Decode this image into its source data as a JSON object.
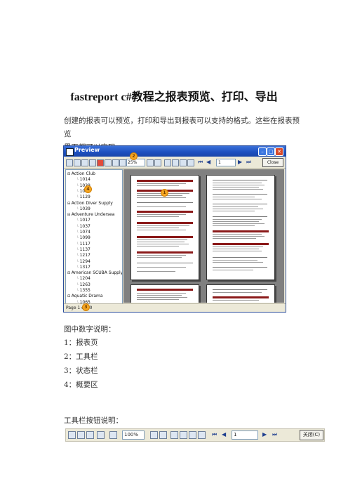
{
  "title": "fastreport c#教程之报表预览、打印、导出",
  "intro_line1": "创建的报表可以预览，打印和导出到报表可以支持的格式。这些在报表预览",
  "intro_line2": "界面都可以实现。",
  "preview_window": {
    "window_title": "Preview",
    "zoom": "25%",
    "page_number": "1",
    "close_label": "Close",
    "status_text": "Page 1 of 30",
    "tree": [
      {
        "type": "group",
        "label": "Action Club"
      },
      {
        "type": "leaf",
        "label": "1014"
      },
      {
        "type": "leaf",
        "label": "1029"
      },
      {
        "type": "leaf",
        "label": "1038"
      },
      {
        "type": "leaf",
        "label": "1129"
      },
      {
        "type": "group",
        "label": "Action Diver Supply"
      },
      {
        "type": "leaf",
        "label": "1039"
      },
      {
        "type": "group",
        "label": "Adventure Undersea"
      },
      {
        "type": "leaf",
        "label": "1017"
      },
      {
        "type": "leaf",
        "label": "1037"
      },
      {
        "type": "leaf",
        "label": "1074"
      },
      {
        "type": "leaf",
        "label": "1099"
      },
      {
        "type": "leaf",
        "label": "1117"
      },
      {
        "type": "leaf",
        "label": "1137"
      },
      {
        "type": "leaf",
        "label": "1217"
      },
      {
        "type": "leaf",
        "label": "1294"
      },
      {
        "type": "leaf",
        "label": "1317"
      },
      {
        "type": "group",
        "label": "American SCUBA Supply"
      },
      {
        "type": "leaf",
        "label": "1204"
      },
      {
        "type": "leaf",
        "label": "1263"
      },
      {
        "type": "leaf",
        "label": "1355"
      },
      {
        "type": "group",
        "label": "Aquatic Drama"
      },
      {
        "type": "leaf",
        "label": "1065"
      }
    ],
    "markers": [
      "1",
      "2",
      "3",
      "4"
    ]
  },
  "legend_heading": "图中数字说明：",
  "legend_items": [
    "1：报表页",
    "2：工具栏",
    "3：状态栏",
    "4：概要区"
  ],
  "toolbar_heading": "工具栏按钮说明：",
  "toolbar_strip": {
    "zoom": "100%",
    "page_number": "1",
    "close_label": "关闭(C)"
  },
  "colors": {
    "report_band": "#8b1a1a",
    "titlebar": "#1c4fbf",
    "badge": "#f5a623"
  }
}
